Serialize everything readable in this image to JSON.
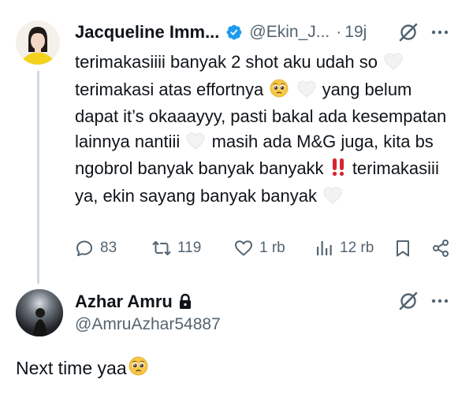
{
  "tweet": {
    "author_name": "Jacqueline Imm...",
    "handle": "@Ekin_J...",
    "separator": "·",
    "time": "19j",
    "text_parts": [
      "terimakasiiii banyak 2 shot aku udah so",
      "terimakasi atas effortnya",
      "yang belum dapat it’s okaaayyy, pasti bakal ada kesempatan lainnya nantiii",
      "masih ada M&G juga, kita bs ngobrol banyak banyak banyakk",
      "terimakasiii ya, ekin sayang banyak banyak"
    ],
    "emojis": {
      "heart": "white-heart-icon",
      "pleading": "pleading-face-icon",
      "exclamation": "double-exclamation-icon"
    },
    "stats": {
      "replies": "83",
      "reposts": "119",
      "likes": "1 rb",
      "views": "12 rb"
    }
  },
  "reply": {
    "author_name": "Azhar Amru",
    "handle": "@AmruAzhar54887",
    "text": "Next time yaa",
    "protected": true
  },
  "colors": {
    "text_primary": "#0f1419",
    "text_secondary": "#536471",
    "verified_blue": "#1d9bf0",
    "thread_line": "#cfd9de"
  }
}
